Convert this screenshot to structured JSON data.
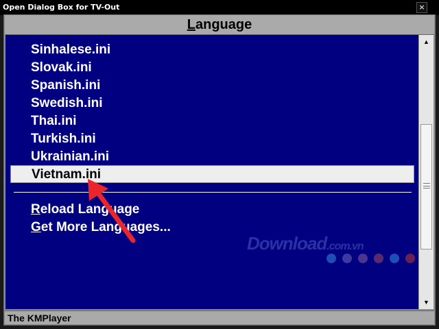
{
  "window": {
    "title": "Open Dialog Box for TV-Out",
    "close_glyph": "×"
  },
  "header": {
    "title_prefix": "L",
    "title_rest": "anguage"
  },
  "languages": [
    {
      "label": "Sinhalese.ini"
    },
    {
      "label": "Slovak.ini"
    },
    {
      "label": "Spanish.ini"
    },
    {
      "label": "Swedish.ini"
    },
    {
      "label": "Thai.ini"
    },
    {
      "label": "Turkish.ini"
    },
    {
      "label": "Ukrainian.ini"
    },
    {
      "label": "Vietnam.ini",
      "selected": true
    }
  ],
  "actions": {
    "reload_prefix": "R",
    "reload_rest": "eload Language",
    "more_prefix": "G",
    "more_rest": "et More Languages..."
  },
  "scrollbar": {
    "up_glyph": "▲",
    "down_glyph": "▼",
    "thumb_position_fraction": 0.62
  },
  "status": {
    "text": "The KMPlayer"
  },
  "watermark": {
    "main": "Download",
    "suffix": ".com.vn"
  },
  "colors": {
    "list_bg": "#000080",
    "selection_bg": "#eeeeee",
    "annotation_arrow": "#e8262b",
    "dots": [
      "#1e4db5",
      "#3a3aa0",
      "#4a3590",
      "#5a2a70",
      "#1e4db5",
      "#6a2050"
    ]
  }
}
